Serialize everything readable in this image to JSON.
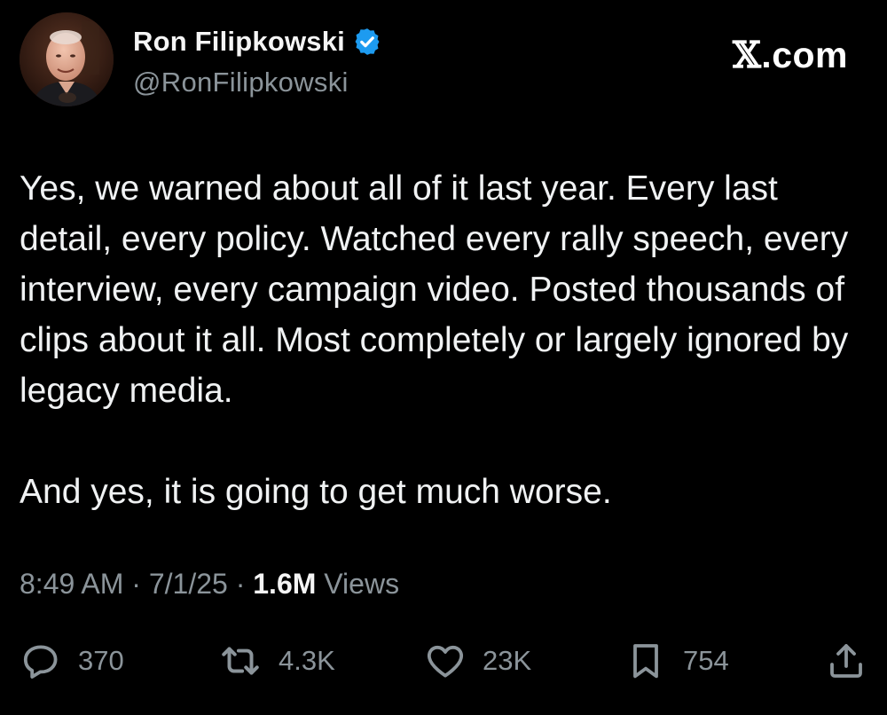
{
  "author": {
    "display_name": "Ron Filipkowski",
    "handle": "@RonFilipkowski",
    "verified": true,
    "avatar_icon": "profile-photo"
  },
  "brand": {
    "x_glyph": "𝕏",
    "domain": ".com"
  },
  "tweet": {
    "paragraphs": [
      "Yes, we warned about all of it last year. Every last detail, every policy. Watched every rally speech, every interview, every campaign video. Posted thousands of clips about it all. Most completely or largely ignored by legacy media.",
      "And yes, it is going to get much worse."
    ],
    "time": "8:49 AM",
    "date": "7/1/25",
    "views_count": "1.6M",
    "views_label": "Views",
    "separator": "·"
  },
  "actions": {
    "replies": "370",
    "reposts": "4.3K",
    "likes": "23K",
    "bookmarks": "754"
  },
  "colors": {
    "background": "#000000",
    "text": "#e7e9ea",
    "secondary_text": "#8b949a",
    "verified_badge": "#1d9bf0"
  }
}
